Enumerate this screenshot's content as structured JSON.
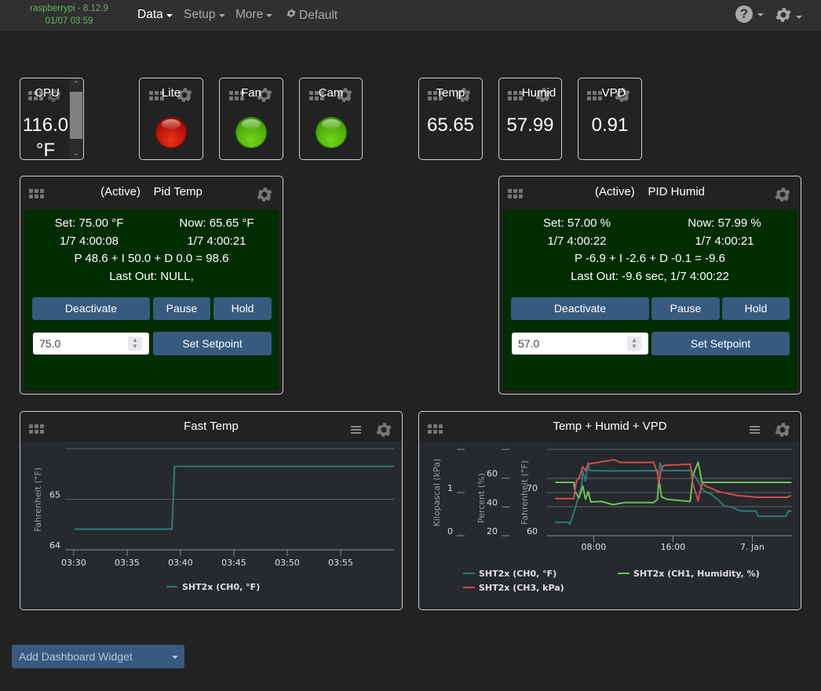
{
  "navbar": {
    "brand_line1": "raspberrypi - 8.12.9",
    "brand_line2": "01/07 03:59",
    "menu": [
      {
        "label": "Data",
        "active": true,
        "dropdown": true
      },
      {
        "label": "Setup",
        "active": false,
        "dropdown": true
      },
      {
        "label": "More",
        "active": false,
        "dropdown": true
      },
      {
        "label": "Default",
        "active": false,
        "dropdown": false,
        "icon": "gear-icon"
      }
    ],
    "right_icons": [
      "help-icon",
      "gear-icon"
    ],
    "help_glyph": "?"
  },
  "measurement_widgets": [
    {
      "id": "cpu",
      "title": "CPU",
      "value_line1": "116.0",
      "value_line2": "°F",
      "scroll_up": "⌃",
      "scroll_down": "⌄"
    },
    {
      "id": "temp",
      "title": "Temp",
      "value": "65.65"
    },
    {
      "id": "humid",
      "title": "Humid",
      "value": "57.99"
    },
    {
      "id": "vpd",
      "title": "VPD",
      "value": "0.91"
    }
  ],
  "output_widgets": [
    {
      "id": "lite",
      "title": "Lite",
      "state": "off",
      "color": "#c8160c"
    },
    {
      "id": "fan",
      "title": "Fan",
      "state": "on",
      "color": "#5cb80a"
    },
    {
      "id": "cam",
      "title": "Cam",
      "state": "on",
      "color": "#5cb80a"
    }
  ],
  "pid_widgets": [
    {
      "id": "pid-temp",
      "status": "(Active)",
      "name": "Pid Temp",
      "set_label": "Set: 75.00 °F",
      "set_time": "1/7 4:00:08",
      "now_label": "Now: 65.65 °F",
      "now_time": "1/7 4:00:21",
      "pid_line": "P 48.6 + I 50.0 + D 0.0 = 98.6",
      "last_out": "Last Out: NULL,",
      "buttons": {
        "deactivate": "Deactivate",
        "pause": "Pause",
        "hold": "Hold",
        "set_setpoint": "Set Setpoint"
      },
      "setpoint_value": "75.0"
    },
    {
      "id": "pid-humid",
      "status": "(Active)",
      "name": "PID Humid",
      "set_label": "Set: 57.00 %",
      "set_time": "1/7 4:00:22",
      "now_label": "Now: 57.99 %",
      "now_time": "1/7 4:00:21",
      "pid_line": "P -6.9 + I -2.6 + D -0.1 = -9.6",
      "last_out": "Last Out: -9.6 sec, 1/7 4:00:22",
      "buttons": {
        "deactivate": "Deactivate",
        "pause": "Pause",
        "hold": "Hold",
        "set_setpoint": "Set Setpoint"
      },
      "setpoint_value": "57.0"
    }
  ],
  "chart_widgets": [
    {
      "id": "fast-temp",
      "title": "Fast Temp"
    },
    {
      "id": "temp-humid-vpd",
      "title": "Temp + Humid + VPD"
    }
  ],
  "add_widget_button": "Add Dashboard Widget",
  "chart_data": [
    {
      "type": "line",
      "title": "Fast Temp",
      "xlabel": "",
      "ylabel": "Fahrenheit (°F)",
      "x_unit": "minutes after 03:00",
      "xlim": [
        29.2,
        60.0
      ],
      "ylim": [
        64,
        66
      ],
      "x_ticks": [
        30,
        35,
        40,
        45,
        50,
        55
      ],
      "x_tick_labels": [
        "03:30",
        "03:35",
        "03:40",
        "03:45",
        "03:50",
        "03:55"
      ],
      "y_ticks": [
        64,
        65,
        66
      ],
      "y_tick_labels": [
        "64",
        "65",
        ""
      ],
      "grid": true,
      "legend": "bottom-center",
      "series": [
        {
          "name": "SHT2x (CH0, °F)",
          "color": "#2b7a78",
          "x": [
            30.05,
            39.2,
            39.45,
            60.0
          ],
          "y": [
            64.41,
            64.41,
            65.65,
            65.65
          ]
        }
      ]
    },
    {
      "type": "line",
      "title": "Temp + Humid + VPD",
      "x_unit": "hours after 6 Jan 00:00",
      "xlim": [
        3.3,
        28.0
      ],
      "x_ticks": [
        8,
        16,
        24
      ],
      "x_tick_labels": [
        "08:00",
        "16:00",
        "7. Jan"
      ],
      "grid": true,
      "legend": "bottom-center",
      "axes": [
        {
          "id": "kpa",
          "label": "Kilopascal (kPa)",
          "ylim": [
            0,
            2
          ],
          "ticks": [
            0,
            1,
            2
          ],
          "tick_labels": [
            "0",
            "1",
            ""
          ]
        },
        {
          "id": "percent",
          "label": "Percent (%)",
          "ylim": [
            20,
            80
          ],
          "ticks": [
            20,
            40,
            60,
            80
          ],
          "tick_labels": [
            "20",
            "40",
            "60",
            ""
          ]
        },
        {
          "id": "fahrenheit",
          "label": "Fahrenheit (°F)",
          "ylim": [
            60,
            80
          ],
          "ticks": [
            60,
            70,
            80
          ],
          "tick_labels": [
            "60",
            "70",
            ""
          ]
        }
      ],
      "series": [
        {
          "name": "SHT2x (CH0, °F)",
          "axis": "fahrenheit",
          "color": "#2b7a78",
          "x": [
            4.12,
            5.45,
            5.6,
            6.0,
            6.39,
            6.79,
            6.89,
            7.18,
            7.45,
            7.58,
            10.0,
            14.44,
            14.5,
            14.7,
            14.97,
            17.88,
            18.27,
            19.07,
            19.86,
            20.65,
            21.17,
            21.96,
            22.5,
            23.03,
            24.34,
            24.61,
            27.38,
            27.64,
            27.96
          ],
          "y": [
            63.1,
            63.1,
            62.6,
            65.4,
            68.4,
            71.5,
            75.1,
            72.7,
            76.9,
            75.1,
            75.0,
            75.1,
            73.9,
            76.9,
            75.1,
            75.1,
            73.6,
            70.5,
            69.6,
            68.1,
            66.9,
            66.6,
            66.0,
            65.7,
            65.7,
            64.5,
            64.5,
            65.7,
            65.7
          ]
        },
        {
          "name": "SHT2x (CH1, Humidity, %)",
          "axis": "percent",
          "color": "#6abf5e",
          "x": [
            4.12,
            6.0,
            6.13,
            6.52,
            6.91,
            7.18,
            7.45,
            7.71,
            8.77,
            9.95,
            11.14,
            14.04,
            14.44,
            14.57,
            14.84,
            15.37,
            17.74,
            18.0,
            18.53,
            18.93,
            27.96
          ],
          "y": [
            57.1,
            57.1,
            50.7,
            46.2,
            54.4,
            45.3,
            50.7,
            43.5,
            43.8,
            41.6,
            43.1,
            43.1,
            45.3,
            59.8,
            47.1,
            45.3,
            43.8,
            61.6,
            71.1,
            57.1,
            57.1
          ]
        },
        {
          "name": "SHT2x (CH3, kPa)",
          "axis": "kpa",
          "color": "#c9504e",
          "x": [
            4.12,
            6.0,
            6.26,
            6.52,
            6.91,
            7.18,
            7.45,
            8.24,
            10.08,
            10.61,
            14.04,
            14.44,
            14.57,
            14.84,
            15.11,
            17.74,
            18.0,
            18.53,
            18.93,
            19.33,
            20.65,
            22.5,
            24.61,
            27.51,
            27.91
          ],
          "y": [
            0.86,
            0.86,
            1.27,
            1.33,
            1.6,
            1.51,
            1.66,
            1.69,
            1.76,
            1.7,
            1.7,
            1.45,
            1.21,
            1.57,
            1.63,
            1.66,
            1.21,
            0.81,
            1.21,
            1.15,
            1.02,
            0.93,
            0.89,
            0.89,
            0.93
          ]
        }
      ]
    }
  ]
}
